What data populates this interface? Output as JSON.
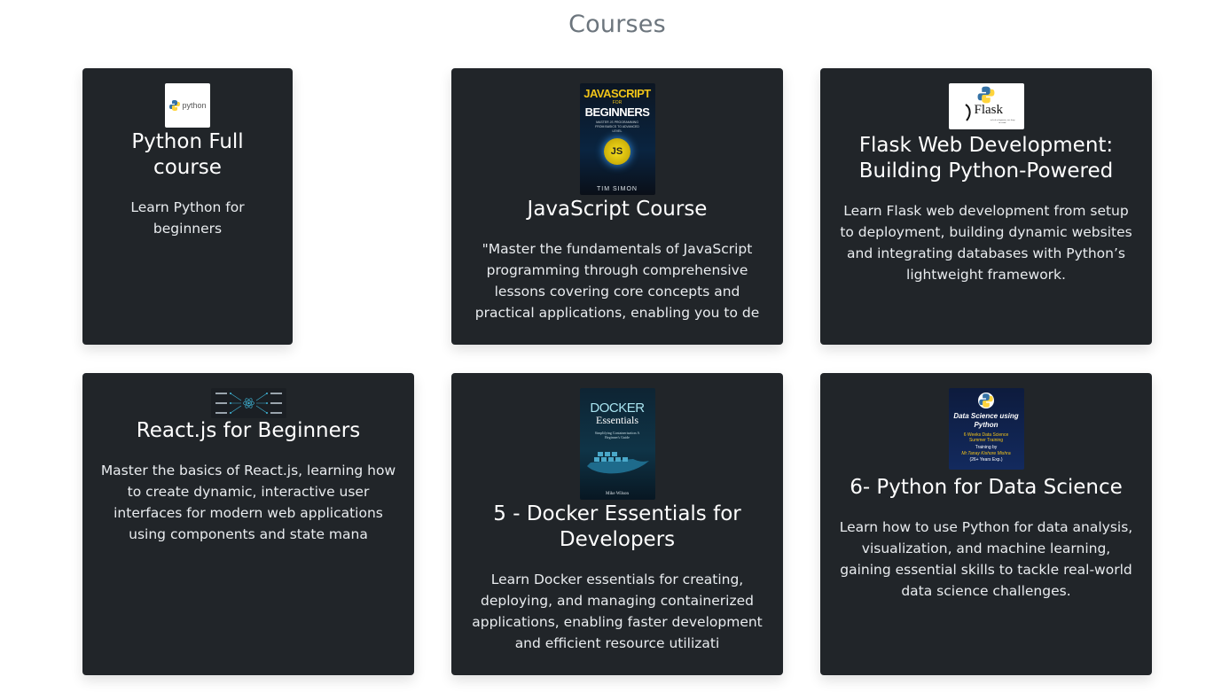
{
  "page": {
    "title": "Courses"
  },
  "courses": [
    {
      "title": "Python Full course",
      "description": "Learn Python for beginners",
      "image_text": "python"
    },
    {
      "title": "JavaScript Course",
      "description": "\"Master the fundamentals of JavaScript programming through comprehensive lessons covering core concepts and practical applications, enabling you to de",
      "image_text": "JAVASCRIPT",
      "image_text2": "FOR",
      "image_text3": "BEGINNERS",
      "image_text4": "MASTER JS PROGRAMMING FROM BASICS TO ADVANCED LEVEL",
      "image_badge": "JS",
      "image_author": "TIM SIMON"
    },
    {
      "title": "Flask Web Development: Building Python-Powered",
      "description": "Learn Flask web development from setup to deployment, building dynamic websites and integrating databases with Python’s lightweight framework.",
      "image_text": "Flask",
      "image_sub": "web development, one drop at a time"
    },
    {
      "title": "React.js for Beginners",
      "description": "Master the basics of React.js, learning how to create dynamic, interactive user interfaces for modern web applications using components and state mana"
    },
    {
      "title": "5 - Docker Essentials for Developers",
      "description": "Learn Docker essentials for creating, deploying, and managing containerized applications, enabling faster development and efficient resource utilizati",
      "image_text": "DOCKER",
      "image_text2": "Essentials",
      "image_sub": "Simplifying Containerization A Beginner's Guide",
      "image_author": "Mike Wilson"
    },
    {
      "title": "6- Python for Data Science",
      "description": "Learn how to use Python for data analysis, visualization, and machine learning, gaining essential skills to tackle real-world data science challenges.",
      "image_text": "Data Science using Python",
      "image_sub": "6 Weeks Data Science Summer Training",
      "image_sub2": "Training by",
      "image_author": "Mr.Tanay Kishore Mishra",
      "image_sub3": "(26+ Years Exp.)"
    }
  ]
}
